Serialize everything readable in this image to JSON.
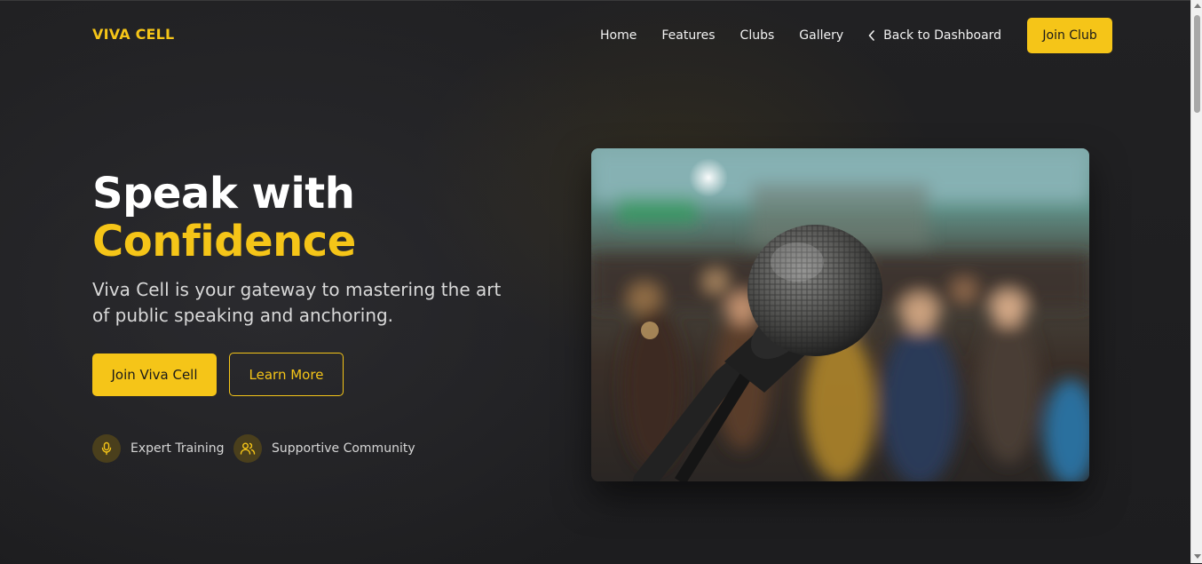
{
  "brand": {
    "name": "VIVA CELL",
    "accent": "#f5c518"
  },
  "nav": {
    "items": [
      {
        "label": "Home"
      },
      {
        "label": "Features"
      },
      {
        "label": "Clubs"
      },
      {
        "label": "Gallery"
      }
    ],
    "back_label": "Back to Dashboard",
    "back_icon": "chevron-left-icon",
    "cta_label": "Join Club"
  },
  "hero": {
    "title_line1": "Speak with",
    "title_line2": "Confidence",
    "subtitle": "Viva Cell is your gateway to mastering the art of public speaking and anchoring.",
    "primary_button": "Join Viva Cell",
    "secondary_button": "Learn More",
    "features": [
      {
        "icon": "microphone-icon",
        "label": "Expert Training"
      },
      {
        "icon": "users-icon",
        "label": "Supportive Community"
      }
    ],
    "image_subject": "microphone on stand with blurred audience"
  }
}
